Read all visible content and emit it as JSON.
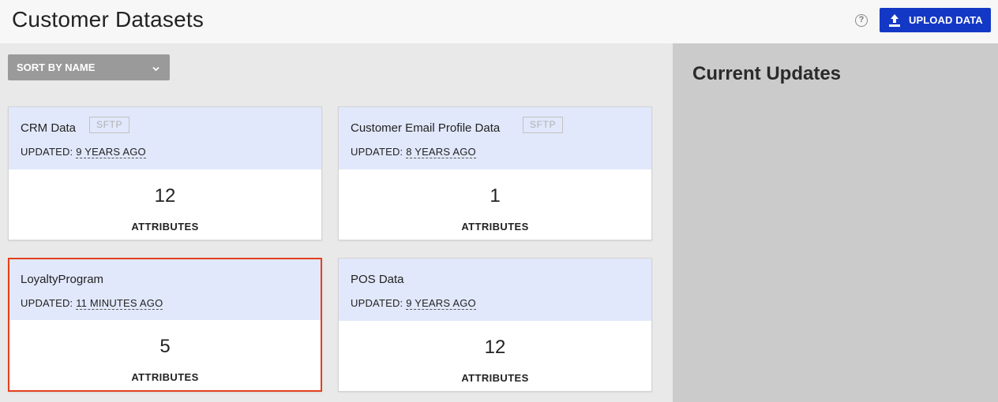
{
  "header": {
    "title": "Customer Datasets",
    "upload_label": "UPLOAD DATA"
  },
  "toolbar": {
    "sort_label": "SORT BY NAME"
  },
  "datasets": [
    {
      "name": "CRM Data",
      "tag": "SFTP",
      "updated_prefix": "UPDATED:",
      "updated_ago": "9 YEARS AGO",
      "count": "12",
      "count_label": "ATTRIBUTES"
    },
    {
      "name": "Customer Email Profile Data",
      "tag": "SFTP",
      "updated_prefix": "UPDATED:",
      "updated_ago": "8 YEARS AGO",
      "count": "1",
      "count_label": "ATTRIBUTES"
    },
    {
      "name": "LoyaltyProgram",
      "updated_prefix": "UPDATED:",
      "updated_ago": "11 MINUTES AGO",
      "count": "5",
      "count_label": "ATTRIBUTES",
      "selected": true
    },
    {
      "name": "POS Data",
      "updated_prefix": "UPDATED:",
      "updated_ago": "9 YEARS AGO",
      "count": "12",
      "count_label": "ATTRIBUTES"
    }
  ],
  "side_panel": {
    "title": "Current Updates"
  },
  "icons": {
    "help": "help-circle-icon",
    "upload": "upload-icon",
    "sort_chevron": "chevron-down-icon"
  },
  "colors": {
    "primary": "#1438c6",
    "selected_border": "#e3401e",
    "card_header": "#e1e8fb",
    "side_panel": "#cbcbcb"
  }
}
